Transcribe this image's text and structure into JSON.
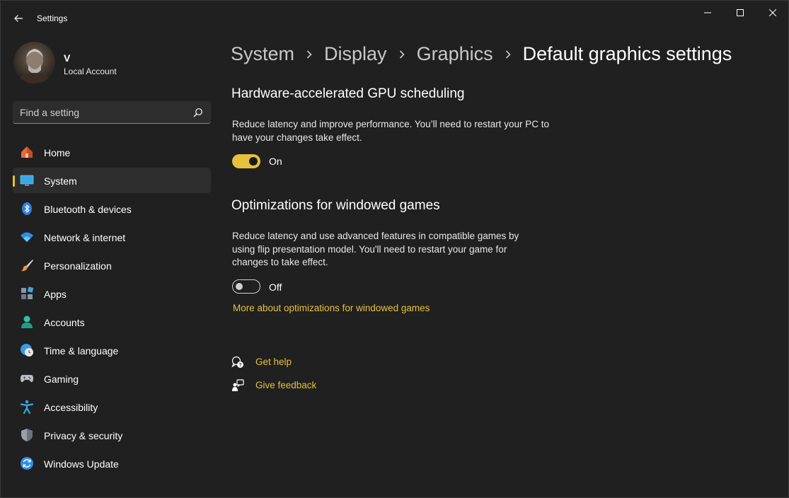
{
  "window": {
    "title": "Settings"
  },
  "profile": {
    "name": "V",
    "account_type": "Local Account"
  },
  "search": {
    "placeholder": "Find a setting"
  },
  "sidebar": {
    "items": [
      {
        "label": "Home",
        "icon": "home-icon"
      },
      {
        "label": "System",
        "icon": "system-icon",
        "active": true
      },
      {
        "label": "Bluetooth & devices",
        "icon": "bluetooth-icon"
      },
      {
        "label": "Network & internet",
        "icon": "wifi-icon"
      },
      {
        "label": "Personalization",
        "icon": "brush-icon"
      },
      {
        "label": "Apps",
        "icon": "apps-icon"
      },
      {
        "label": "Accounts",
        "icon": "accounts-icon"
      },
      {
        "label": "Time & language",
        "icon": "globe-clock-icon"
      },
      {
        "label": "Gaming",
        "icon": "gamepad-icon"
      },
      {
        "label": "Accessibility",
        "icon": "accessibility-icon"
      },
      {
        "label": "Privacy & security",
        "icon": "shield-icon"
      },
      {
        "label": "Windows Update",
        "icon": "update-icon"
      }
    ]
  },
  "breadcrumb": {
    "items": [
      "System",
      "Display",
      "Graphics",
      "Default graphics settings"
    ]
  },
  "sections": {
    "gpu": {
      "title": "Hardware-accelerated GPU scheduling",
      "description": "Reduce latency and improve performance. You’ll need to restart your PC to have your changes take effect.",
      "state": "On"
    },
    "windowed": {
      "title": "Optimizations for windowed games",
      "description": "Reduce latency and use advanced features in compatible games by using flip presentation model. You'll need to restart your game for changes to take effect.",
      "state": "Off",
      "link": "More about optimizations for windowed games"
    }
  },
  "help": {
    "get_help": "Get help",
    "give_feedback": "Give feedback"
  },
  "colors": {
    "accent": "#e6c13b",
    "background": "#202020",
    "nav_active": "#2d2d2d"
  }
}
